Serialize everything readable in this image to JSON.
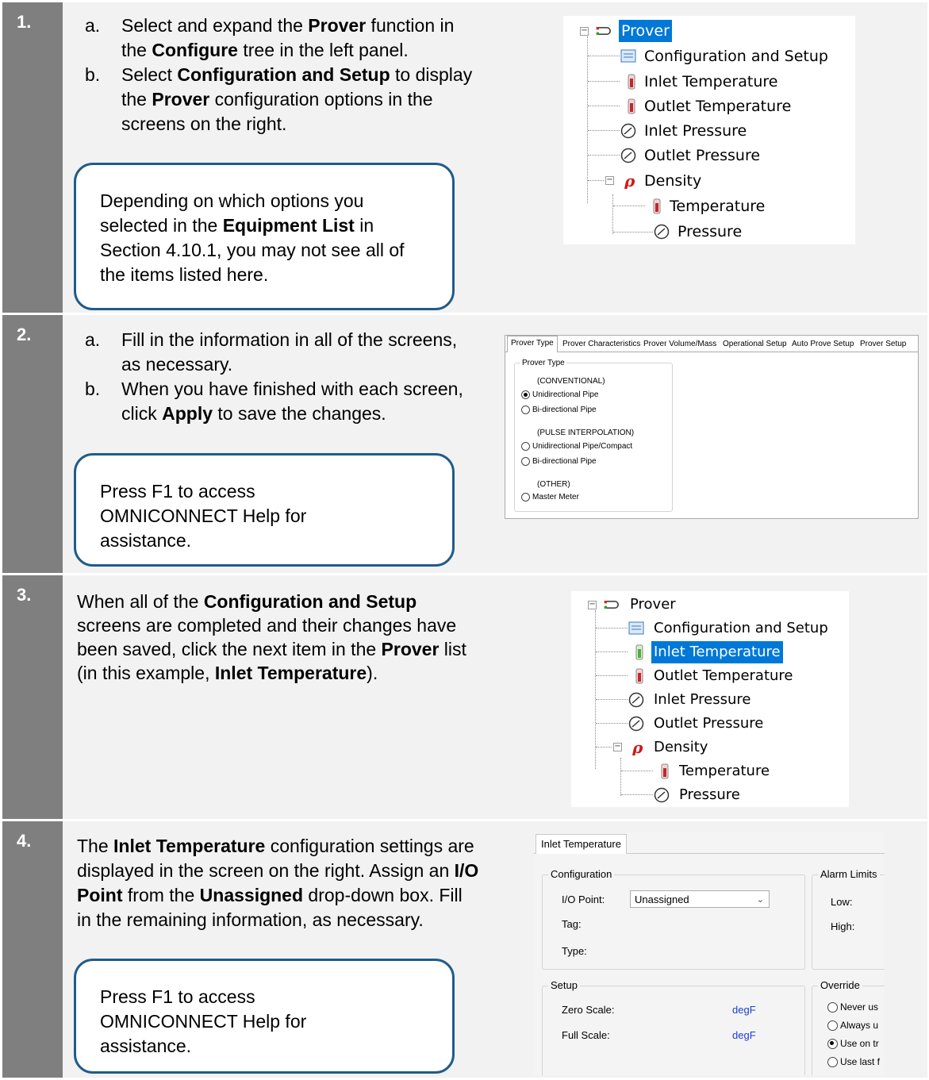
{
  "steps": [
    {
      "number": "1.",
      "items": [
        {
          "letter": "a.",
          "parts": [
            "Select and expand the ",
            "Prover",
            " function in the ",
            "Configure",
            " tree in the left panel."
          ]
        },
        {
          "letter": "b.",
          "parts": [
            "Select ",
            "Configuration and Setup",
            " to display the ",
            "Prover",
            " configuration options in the screens on the right."
          ]
        }
      ],
      "callout": {
        "parts": [
          "Depending on which options you selected in the ",
          "Equipment List",
          " in Section 4.10.1, you may not see all of the items listed here."
        ]
      }
    },
    {
      "number": "2.",
      "items": [
        {
          "letter": "a.",
          "parts": [
            "Fill in the information in all of the screens, as necessary."
          ]
        },
        {
          "letter": "b.",
          "parts": [
            "When you have finished with each screen, click ",
            "Apply",
            " to save the changes."
          ]
        }
      ],
      "callout": {
        "text": "Press F1 to access OMNICONNECT Help for assistance."
      }
    },
    {
      "number": "3.",
      "parts": [
        "When all of the ",
        "Configuration and Setup",
        " screens are completed and their changes have been saved, click the next item in the ",
        "Prover",
        " list (in this example, ",
        "Inlet Temperature",
        ")."
      ]
    },
    {
      "number": "4.",
      "parts": [
        "The ",
        "Inlet Temperature",
        " configuration settings are displayed in the screen on the right. Assign an ",
        "I/O Point",
        " from the ",
        "Unassigned",
        " drop-down box. Fill in the remaining information, as necessary."
      ],
      "callout": {
        "text": "Press F1 to access OMNICONNECT Help for assistance."
      }
    }
  ],
  "tree": {
    "root": "Prover",
    "children": [
      "Configuration and Setup",
      "Inlet Temperature",
      "Outlet Temperature",
      "Inlet Pressure",
      "Outlet Pressure"
    ],
    "density": "Density",
    "density_children": [
      "Temperature",
      "Pressure"
    ]
  },
  "prover_panel": {
    "tabs": [
      "Prover Type",
      "Prover Characteristics",
      "Prover Volume/Mass",
      "Operational Setup",
      "Auto Prove Setup",
      "Prover Setup"
    ],
    "group_title": "Prover Type",
    "conventional_label": "(CONVENTIONAL)",
    "options_conventional": [
      "Unidirectional Pipe",
      "Bi-directional Pipe"
    ],
    "pulse_label": "(PULSE INTERPOLATION)",
    "options_pulse": [
      "Unidirectional Pipe/Compact",
      "Bi-directional Pipe"
    ],
    "other_label": "(OTHER)",
    "options_other": [
      "Master Meter"
    ],
    "selected": "Unidirectional Pipe"
  },
  "inlet_panel": {
    "tab": "Inlet Temperature",
    "config_title": "Configuration",
    "io_point_label": "I/O Point:",
    "io_point_value": "Unassigned",
    "tag_label": "Tag:",
    "type_label": "Type:",
    "alarm_title": "Alarm Limits",
    "low_label": "Low:",
    "high_label": "High:",
    "setup_title": "Setup",
    "zero_label": "Zero Scale:",
    "full_label": "Full Scale:",
    "unit": "degF",
    "override_title": "Override",
    "override_options": [
      "Never us",
      "Always u",
      "Use on tr",
      "Use last f"
    ]
  },
  "colors": {
    "step_number_bg": "#7f7f7f",
    "row_bg": "#f2f2f2",
    "callout_border": "#1f5c8b",
    "selection": "#0078d7"
  }
}
